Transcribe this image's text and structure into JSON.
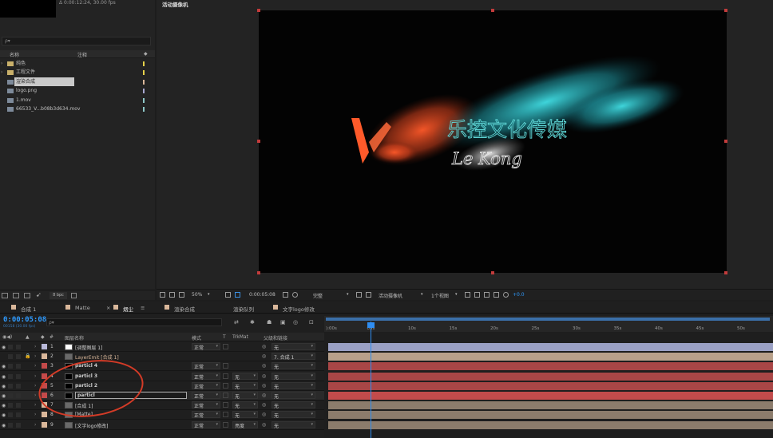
{
  "project": {
    "thumb_info": "Δ 0:00:12:24, 30.00 fps",
    "search_placeholder": "ρ▾",
    "col_name": "名称",
    "col_comment": "注释",
    "items": [
      {
        "name": "纯色",
        "color": "#e6d14a",
        "icon": "folder-icon"
      },
      {
        "name": "工程文件",
        "color": "#e6d14a",
        "icon": "folder-icon"
      },
      {
        "name": "渲染合成",
        "color": "#d9b79a",
        "icon": "composition-icon",
        "selected": true
      },
      {
        "name": "logo.png",
        "color": "#a7a7d0",
        "icon": "image-file-icon"
      },
      {
        "name": "1.mov",
        "color": "#8ec8c8",
        "icon": "footage-icon"
      },
      {
        "name": "66533_V...b08b3d634.mov",
        "color": "#8ec8c8",
        "icon": "footage-icon"
      }
    ],
    "bpc": "8 bpc"
  },
  "comp": {
    "viewer_title": "活动摄像机",
    "artwork": {
      "chinese_title": "乐控文化传媒",
      "script_text": "Le Kong"
    },
    "toolbar": {
      "zoom": "50%",
      "time": "0:00:05:08",
      "resolution": "完整",
      "camera": "活动摄像机",
      "views": "1个视图",
      "exposure": "+0.0"
    }
  },
  "tabs": [
    {
      "label": "合成 1",
      "color": "#d9b79a"
    },
    {
      "label": "Matte",
      "color": "#d9b79a"
    },
    {
      "label": "烟尘",
      "color": "#d9b79a",
      "active": true
    },
    {
      "label": "渲染合成",
      "color": "#d9b79a"
    },
    {
      "label": "渲染队列",
      "color": ""
    },
    {
      "label": "文字logo修改",
      "color": "#d9b79a"
    }
  ],
  "timeline": {
    "timecode": "0:00:05:08",
    "timecode_sub": "00158 (30.00 fps)",
    "search_placeholder": "ρ▾",
    "headers": {
      "layer_name": "图层名称",
      "mode": "模式",
      "t": "T",
      "trkmat": "TrkMat",
      "parent": "父级和链接"
    },
    "ruler_labels": [
      "):00s",
      "05s",
      "10s",
      "15s",
      "20s",
      "25s",
      "30s",
      "35s",
      "40s",
      "45s",
      "50s"
    ],
    "layers": [
      {
        "num": "1",
        "name": "[调整图层 1]",
        "mode": "正常",
        "trkmat": "",
        "parent": "无",
        "label": "#b8b8d8",
        "bar": "#9aa0c4"
      },
      {
        "num": "2",
        "name": "LayerEmit [合成 1]",
        "mode": "",
        "trkmat": "",
        "parent": "7. 合成 1",
        "label": "#d9b79a",
        "bar": "#b8a08a"
      },
      {
        "num": "3",
        "name": "particl 4",
        "mode": "正常",
        "trkmat": "",
        "parent": "无",
        "label": "#c44a4a",
        "bar": "#a94646"
      },
      {
        "num": "4",
        "name": "particl 3",
        "mode": "正常",
        "trkmat": "无",
        "parent": "无",
        "label": "#c44a4a",
        "bar": "#a94646"
      },
      {
        "num": "5",
        "name": "particl 2",
        "mode": "正常",
        "trkmat": "无",
        "parent": "无",
        "label": "#c44a4a",
        "bar": "#a94646"
      },
      {
        "num": "6",
        "name": "particl",
        "mode": "正常",
        "trkmat": "无",
        "parent": "无",
        "label": "#c44a4a",
        "bar": "#c24b4b"
      },
      {
        "num": "7",
        "name": "[合成 1]",
        "mode": "正常",
        "trkmat": "无",
        "parent": "无",
        "label": "#d9b79a",
        "bar": "#8c7c6c"
      },
      {
        "num": "8",
        "name": "[Matte]",
        "mode": "正常",
        "trkmat": "无",
        "parent": "无",
        "label": "#d9b79a",
        "bar": "#8c7c6c"
      },
      {
        "num": "9",
        "name": "[文字logo修改]",
        "mode": "正常",
        "trkmat": "亮度",
        "parent": "无",
        "label": "#d9b79a",
        "bar": "#8c7c6c"
      }
    ]
  }
}
